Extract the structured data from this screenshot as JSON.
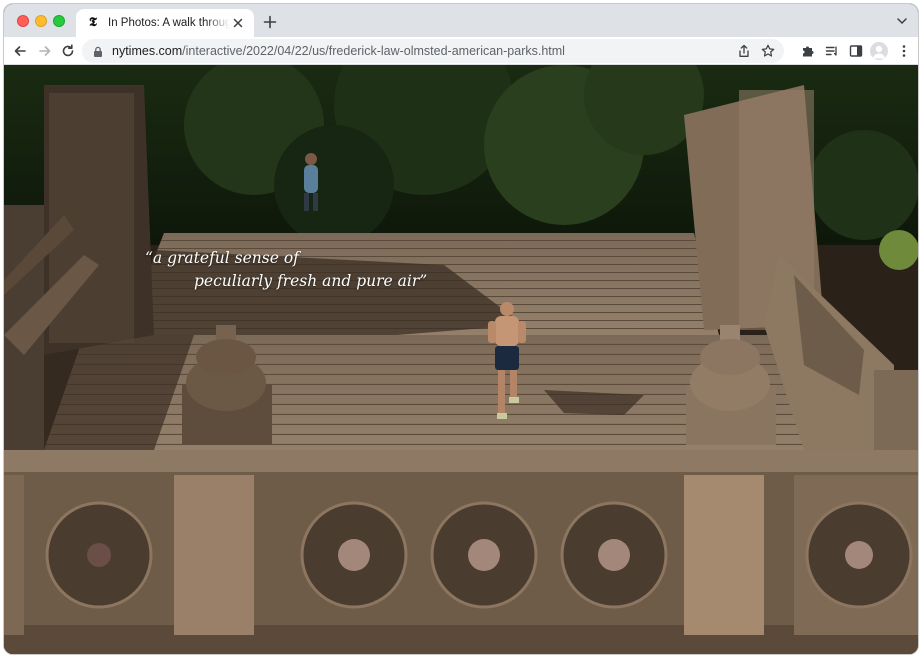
{
  "browser": {
    "tab": {
      "favicon": "𝕿",
      "title": "In Photos: A walk through Frederick Law Olmsted's American Parks",
      "close_icon": "close-icon"
    },
    "new_tab_icon": "plus-icon",
    "url": {
      "host": "nytimes.com",
      "path": "/interactive/2022/04/22/us/frederick-law-olmsted-american-parks.html"
    }
  },
  "article": {
    "quote_line1": "“a grateful sense of",
    "quote_line2": "peculiarly fresh and pure air”"
  },
  "colors": {
    "tabstrip": "#dee1e6",
    "omnibox": "#f1f3f4",
    "stone": "#8b7560",
    "foliage": "#1d2a14"
  }
}
